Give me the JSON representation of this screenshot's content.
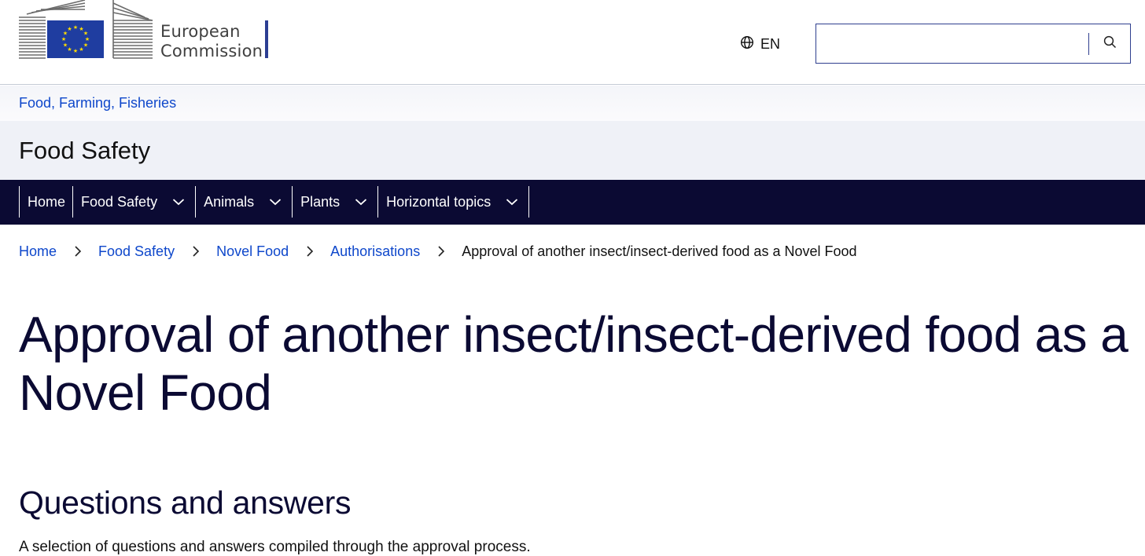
{
  "header": {
    "logo_line1": "European",
    "logo_line2": "Commission",
    "language_code": "EN",
    "search": {
      "value": "",
      "placeholder": ""
    },
    "icons": {
      "language": "globe-icon",
      "search": "search-icon"
    }
  },
  "site": {
    "parent_link": "Food, Farming, Fisheries",
    "name": "Food Safety"
  },
  "nav": {
    "items": [
      {
        "label": "Home",
        "has_dropdown": false
      },
      {
        "label": "Food Safety",
        "has_dropdown": true
      },
      {
        "label": "Animals",
        "has_dropdown": true
      },
      {
        "label": "Plants",
        "has_dropdown": true
      },
      {
        "label": "Horizontal topics",
        "has_dropdown": true
      }
    ]
  },
  "breadcrumb": {
    "items": [
      "Home",
      "Food Safety",
      "Novel Food",
      "Authorisations"
    ],
    "current": "Approval of another insect/insect-derived food as a Novel Food"
  },
  "page": {
    "title": "Approval of another insect/insect-derived food as a Novel Food",
    "section_heading": "Questions and answers",
    "section_intro": "A selection of questions and answers compiled through the approval process."
  },
  "colors": {
    "link": "#0e47cb",
    "nav_background": "#0b0a33",
    "site_band": "#eff1f7",
    "eu_blue": "#1f3da0",
    "eu_yellow": "#ffdd00"
  }
}
